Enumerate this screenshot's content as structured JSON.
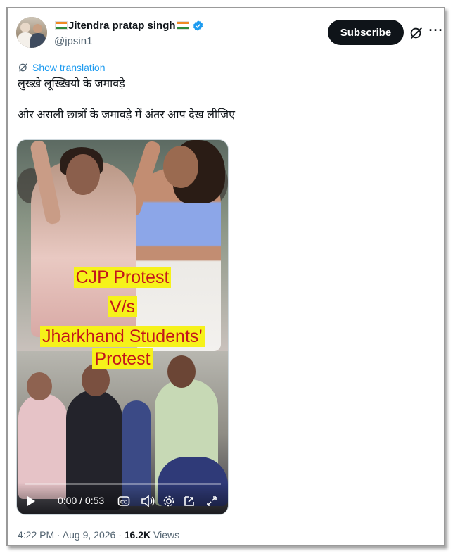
{
  "tweet": {
    "author": {
      "display_name": "Jitendra pratap singh",
      "handle": "@jpsin1",
      "verified": true,
      "flags": [
        "india-flag-icon",
        "india-flag-icon"
      ]
    },
    "subscribe_label": "Subscribe",
    "show_translation": "Show translation",
    "text_line1": "लुख्खे लूख्खियो  के जमावड़े",
    "text_line2": "और असली छात्रों के जमावड़े  में अंतर आप देख लीजिए",
    "video": {
      "overlay_line1": "CJP Protest",
      "overlay_line2": "V/s",
      "overlay_line3": "Jharkhand Students’",
      "overlay_line4": "Protest",
      "time_display": "0:00 / 0:53",
      "progress_fraction": 0.0
    },
    "timestamp": "4:22 PM · Aug 9, 2026 ·",
    "views_count": "16.2K",
    "views_label": "Views"
  },
  "colors": {
    "accent": "#1d9bf0",
    "subscribe_bg": "#0f1419",
    "caption_bg": "#f6f21a",
    "caption_text": "#c3161c"
  }
}
